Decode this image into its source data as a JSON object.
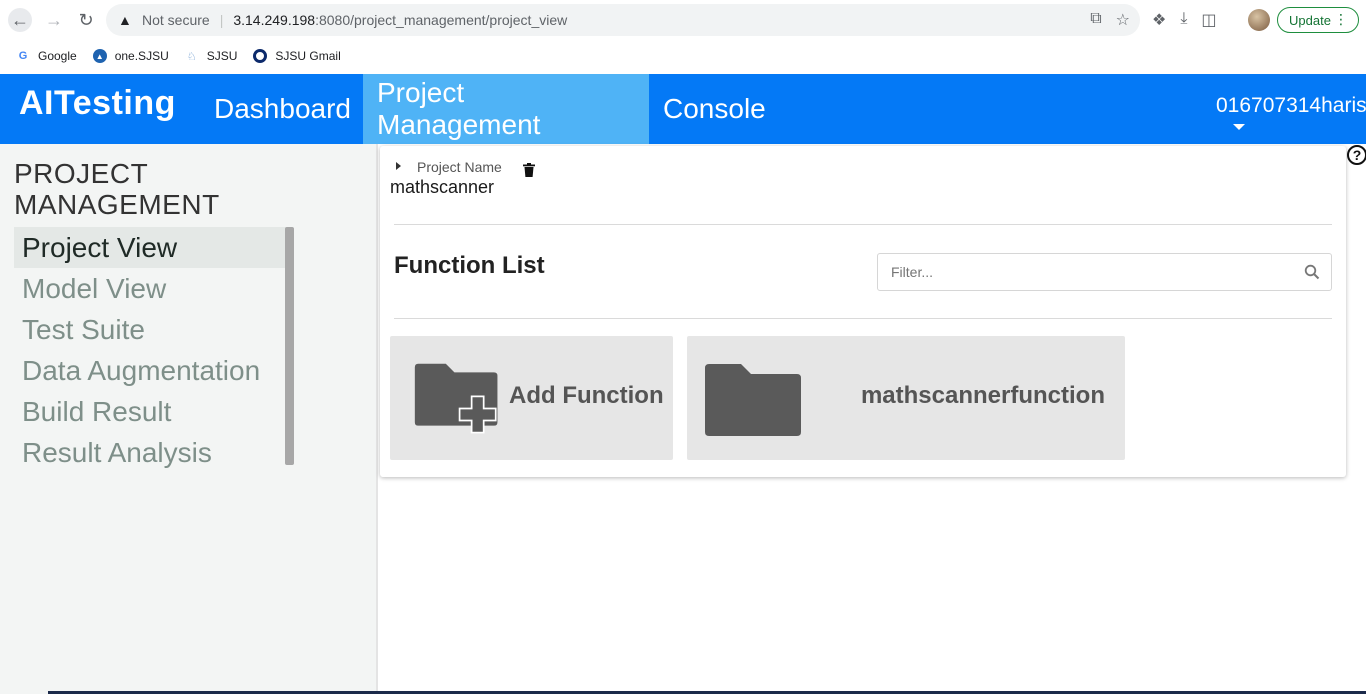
{
  "browser": {
    "security_label": "Not secure",
    "url_host": "3.14.249.198",
    "url_path": ":8080/project_management/project_view",
    "update_label": "Update",
    "bookmarks": [
      {
        "label": "Google",
        "icon": "google-icon"
      },
      {
        "label": "one.SJSU",
        "icon": "one-sjsu-icon"
      },
      {
        "label": "SJSU",
        "icon": "sjsu-icon"
      },
      {
        "label": "SJSU Gmail",
        "icon": "sjsu-gmail-icon"
      }
    ]
  },
  "header": {
    "brand": "AITesting",
    "nav": [
      "Dashboard",
      "Project Management",
      "Console"
    ],
    "active_nav": "Project Management",
    "user": "016707314harish",
    "color": "#0479f6",
    "active_color": "#4fb3f6"
  },
  "sidebar": {
    "title_line1": "PROJECT",
    "title_line2": "MANAGEMENT",
    "items": [
      "Project View",
      "Model View",
      "Test Suite",
      "Data Augmentation",
      "Build Result",
      "Result Analysis"
    ],
    "active": "Project View"
  },
  "project": {
    "label": "Project Name",
    "name": "mathscanner"
  },
  "functions": {
    "title": "Function List",
    "filter_placeholder": "Filter...",
    "add_label": "Add Function",
    "items": [
      "mathscannerfunction"
    ]
  }
}
